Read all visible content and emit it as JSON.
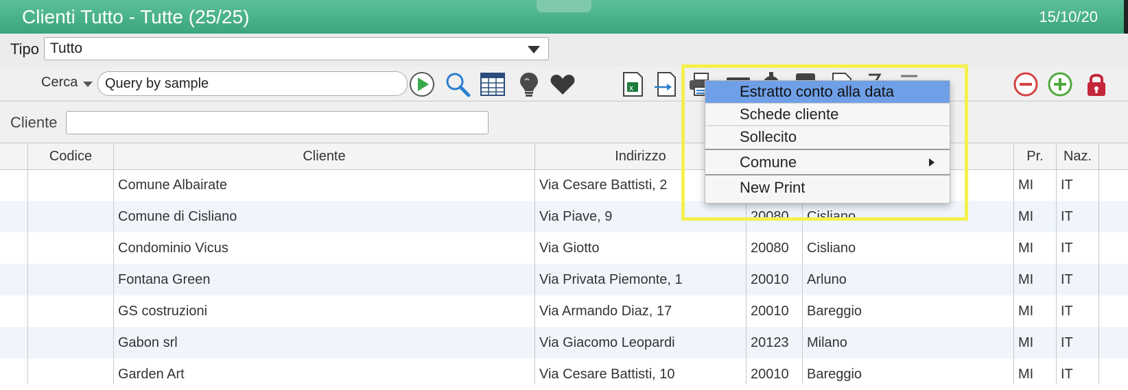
{
  "window": {
    "title": "Clienti Tutto - Tutte (25/25)",
    "date": "15/10/20"
  },
  "filter": {
    "tipo_label": "Tipo",
    "tipo_value": "Tutto"
  },
  "search": {
    "mode_label": "Cerca",
    "query_value": "Query by sample"
  },
  "cliente": {
    "label": "Cliente",
    "value": ""
  },
  "toolbar_icons": [
    "play-icon",
    "search-icon",
    "table-icon",
    "lightbulb-icon",
    "heart-icon",
    "excel-icon",
    "export-icon",
    "print-icon",
    "card-icon",
    "gear-icon",
    "tray-icon",
    "document-icon",
    "arrow-icon",
    "minus-icon",
    "remove-icon",
    "add-icon",
    "lock-icon"
  ],
  "colors": {
    "title_bar": "#46b084",
    "menu_selection": "#6f9fe6",
    "highlight_box": "#f4f050",
    "remove": "#d64040",
    "add": "#4caa3a",
    "lock": "#c4263a"
  },
  "table": {
    "columns": [
      "Codice",
      "Cliente",
      "Indirizzo",
      "Pr.",
      "Naz."
    ],
    "rows": [
      {
        "codice": "",
        "cliente": "Comune Albairate",
        "indirizzo": "Via Cesare Battisti, 2",
        "cap": "",
        "comune": "",
        "pr": "MI",
        "naz": "IT"
      },
      {
        "codice": "",
        "cliente": "Comune di Cisliano",
        "indirizzo": "Via Piave, 9",
        "cap": "20080",
        "comune": "Cisliano",
        "pr": "MI",
        "naz": "IT"
      },
      {
        "codice": "",
        "cliente": "Condominio Vicus",
        "indirizzo": "Via Giotto",
        "cap": "20080",
        "comune": "Cisliano",
        "pr": "MI",
        "naz": "IT"
      },
      {
        "codice": "",
        "cliente": "Fontana Green",
        "indirizzo": "Via Privata Piemonte, 1",
        "cap": "20010",
        "comune": "Arluno",
        "pr": "MI",
        "naz": "IT"
      },
      {
        "codice": "",
        "cliente": "GS costruzioni",
        "indirizzo": "Via Armando Diaz, 17",
        "cap": "20010",
        "comune": "Bareggio",
        "pr": "MI",
        "naz": "IT"
      },
      {
        "codice": "",
        "cliente": "Gabon srl",
        "indirizzo": "Via Giacomo Leopardi",
        "cap": "20123",
        "comune": "Milano",
        "pr": "MI",
        "naz": "IT"
      },
      {
        "codice": "",
        "cliente": "Garden Art",
        "indirizzo": "Via Cesare Battisti, 10",
        "cap": "20010",
        "comune": "Bareggio",
        "pr": "MI",
        "naz": "IT"
      }
    ]
  },
  "print_menu": {
    "items": [
      "Estratto conto alla data",
      "Schede cliente",
      "Sollecito",
      "Comune",
      "New Print"
    ],
    "selected": "Estratto conto alla data"
  }
}
